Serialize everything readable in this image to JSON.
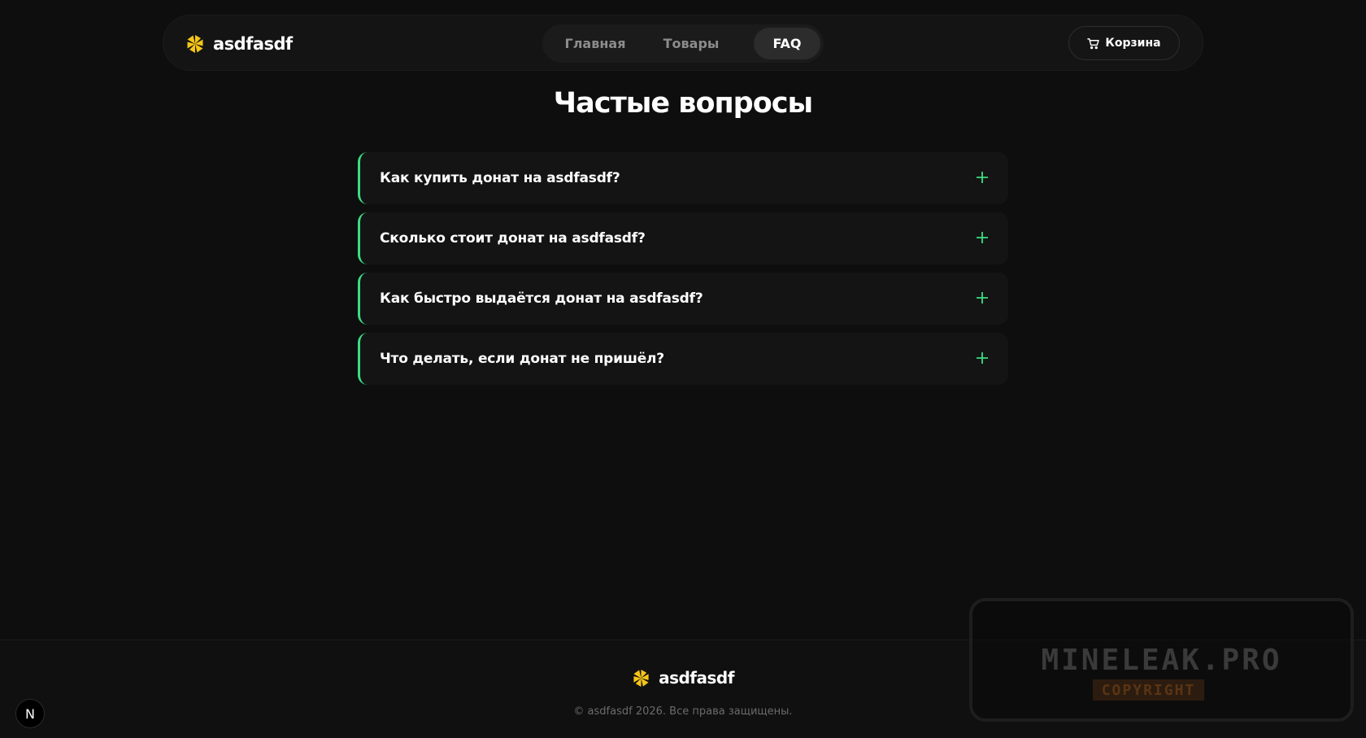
{
  "header": {
    "brand_name": "asdfasdf",
    "logo_icon": "yellow-pinwheel-icon",
    "nav": [
      {
        "label": "Главная",
        "active": false
      },
      {
        "label": "Товары",
        "active": false
      },
      {
        "label": "FAQ",
        "active": true
      }
    ],
    "cart_label": "Корзина",
    "cart_icon": "cart-icon"
  },
  "page_title": "Частые вопросы",
  "faq": [
    {
      "question": "Как купить донат на asdfasdf?"
    },
    {
      "question": "Сколько стоит донат на asdfasdf?"
    },
    {
      "question": "Как быстро выдаётся донат на asdfasdf?"
    },
    {
      "question": "Что делать, если донат не пришёл?"
    }
  ],
  "footer": {
    "brand_name": "asdfasdf",
    "copyright": "© asdfasdf 2026. Все права защищены."
  },
  "dev_badge": "N",
  "watermark": {
    "title": "MINELEAK.PRO",
    "subtitle": "COPYRIGHT"
  },
  "colors": {
    "accent_green": "#3ddc84",
    "logo_yellow": "#f5c518",
    "background": "#0e0e0e"
  }
}
